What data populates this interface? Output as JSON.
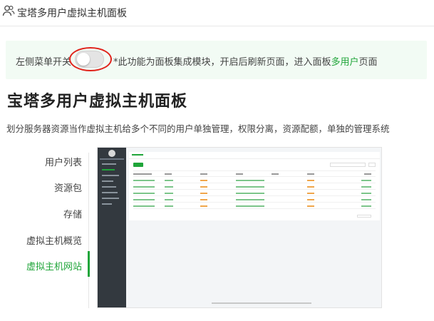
{
  "window": {
    "title": "宝塔多用户虚拟主机面板",
    "icon": "users-icon"
  },
  "notice": {
    "toggle_label": "左侧菜单开关",
    "toggle_state": "off",
    "message_prefix": "*此功能为面板集成模块，开启后刷新页面，进入面板",
    "message_link": "多用户",
    "message_suffix": "页面"
  },
  "main": {
    "heading": "宝塔多用户虚拟主机面板",
    "description": "划分服务器资源当作虚拟主机给多个不同的用户单独管理，权限分离，资源配额，单独的管理系统"
  },
  "menu": {
    "items": [
      {
        "label": "用户列表",
        "active": false
      },
      {
        "label": "资源包",
        "active": false
      },
      {
        "label": "存储",
        "active": false
      },
      {
        "label": "虚拟主机概览",
        "active": false
      },
      {
        "label": "虚拟主机网站",
        "active": true
      }
    ]
  },
  "colors": {
    "accent": "#20a53a",
    "highlight_ring": "#e0231b",
    "notice_bg": "#f2fbf4"
  }
}
